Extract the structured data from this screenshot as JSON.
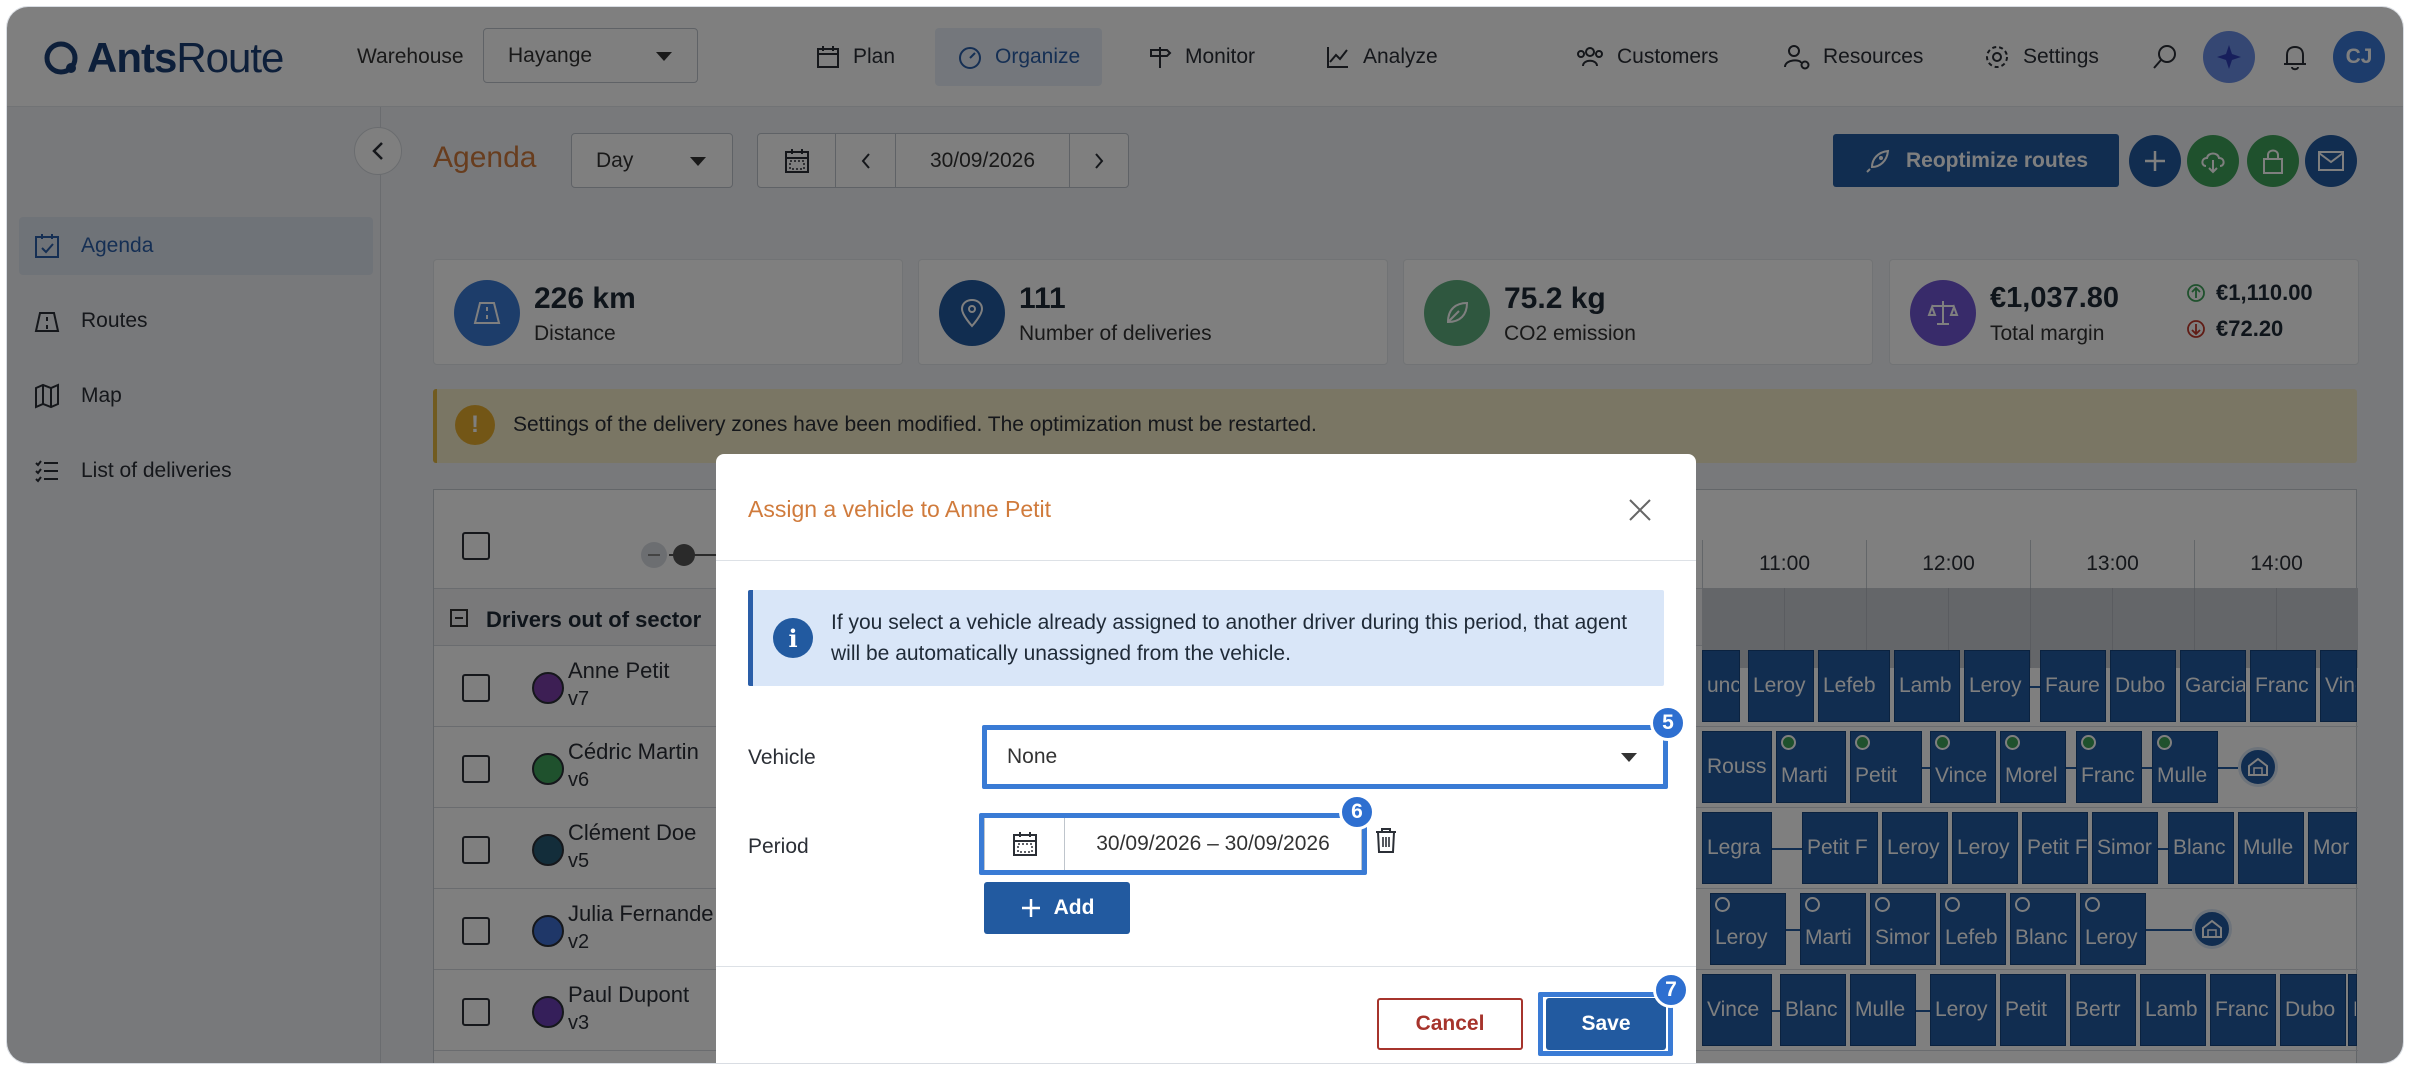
{
  "app": {
    "brand_bold": "Ants",
    "brand_light": "Route",
    "user_initials": "CJ"
  },
  "header": {
    "warehouse_label": "Warehouse",
    "warehouse_value": "Hayange",
    "nav": [
      {
        "label": "Plan",
        "icon": "calendar-icon"
      },
      {
        "label": "Organize",
        "icon": "gauge-icon",
        "active": true
      },
      {
        "label": "Monitor",
        "icon": "signpost-icon"
      },
      {
        "label": "Analyze",
        "icon": "chart-icon"
      }
    ],
    "right_nav": [
      {
        "label": "Customers",
        "icon": "users-icon"
      },
      {
        "label": "Resources",
        "icon": "user-gear-icon"
      },
      {
        "label": "Settings",
        "icon": "gear-icon"
      }
    ]
  },
  "sidebar": {
    "items": [
      {
        "label": "Agenda",
        "icon": "calendar-check-icon",
        "active": true
      },
      {
        "label": "Routes",
        "icon": "road-icon"
      },
      {
        "label": "Map",
        "icon": "map-icon"
      },
      {
        "label": "List of deliveries",
        "icon": "list-icon"
      }
    ]
  },
  "toolbar": {
    "title": "Agenda",
    "view_value": "Day",
    "date": "30/09/2026",
    "reoptimize_label": "Reoptimize routes"
  },
  "kpis": {
    "distance": {
      "value": "226 km",
      "label": "Distance"
    },
    "deliveries": {
      "value": "111",
      "label": "Number of deliveries"
    },
    "co2": {
      "value": "75.2 kg",
      "label": "CO2 emission"
    },
    "margin": {
      "value": "€1,037.80",
      "label": "Total margin",
      "up": "€1,110.00",
      "down": "€72.20"
    }
  },
  "warning": {
    "text": "Settings of the delivery zones have been modified. The optimization must be restarted."
  },
  "grid": {
    "section_title": "Drivers out of sector",
    "hours": [
      "11:00",
      "12:00",
      "13:00",
      "14:00"
    ],
    "drivers": [
      {
        "name": "Anne Petit",
        "vehicle": "v7",
        "color": "#7b3fa8"
      },
      {
        "name": "Cédric Martin",
        "vehicle": "v6",
        "color": "#3fa35a"
      },
      {
        "name": "Clément Doe",
        "vehicle": "v5",
        "color": "#275a75"
      },
      {
        "name": "Julia Fernande",
        "vehicle": "v2",
        "color": "#3f6fd0"
      },
      {
        "name": "Paul Dupont",
        "vehicle": "v3",
        "color": "#6a3fb5"
      }
    ],
    "stops": [
      [
        "unc",
        "Leroy",
        "Lefeb",
        "Lamb",
        "Leroy",
        "Faure",
        "Dubo",
        "Garcia",
        "Franc",
        "Vinc"
      ],
      [
        "Rouss",
        "Marti",
        "Petit",
        "Vince",
        "Morel",
        "Franc",
        "Mulle"
      ],
      [
        "Legra",
        "Petit F",
        "Leroy",
        "Leroy",
        "Petit F",
        "Simor",
        "Blanc",
        "Mulle",
        "Mor"
      ],
      [
        "Leroy",
        "Marti",
        "Simor",
        "Lefeb",
        "Blanc",
        "Leroy"
      ],
      [
        "Vince",
        "Blanc",
        "Mulle",
        "Leroy",
        "Petit",
        "Bertr",
        "Lamb",
        "Franc",
        "Dubo",
        "R"
      ]
    ]
  },
  "modal": {
    "title": "Assign a vehicle to Anne Petit",
    "info": "If you select a vehicle already assigned to another driver during this period, that agent will be automatically unassigned from the vehicle.",
    "vehicle_label": "Vehicle",
    "vehicle_value": "None",
    "period_label": "Period",
    "period_value": "30/09/2026 – 30/09/2026",
    "add_label": "Add",
    "cancel_label": "Cancel",
    "save_label": "Save",
    "badges": {
      "vehicle": "5",
      "period": "6",
      "save": "7"
    }
  }
}
